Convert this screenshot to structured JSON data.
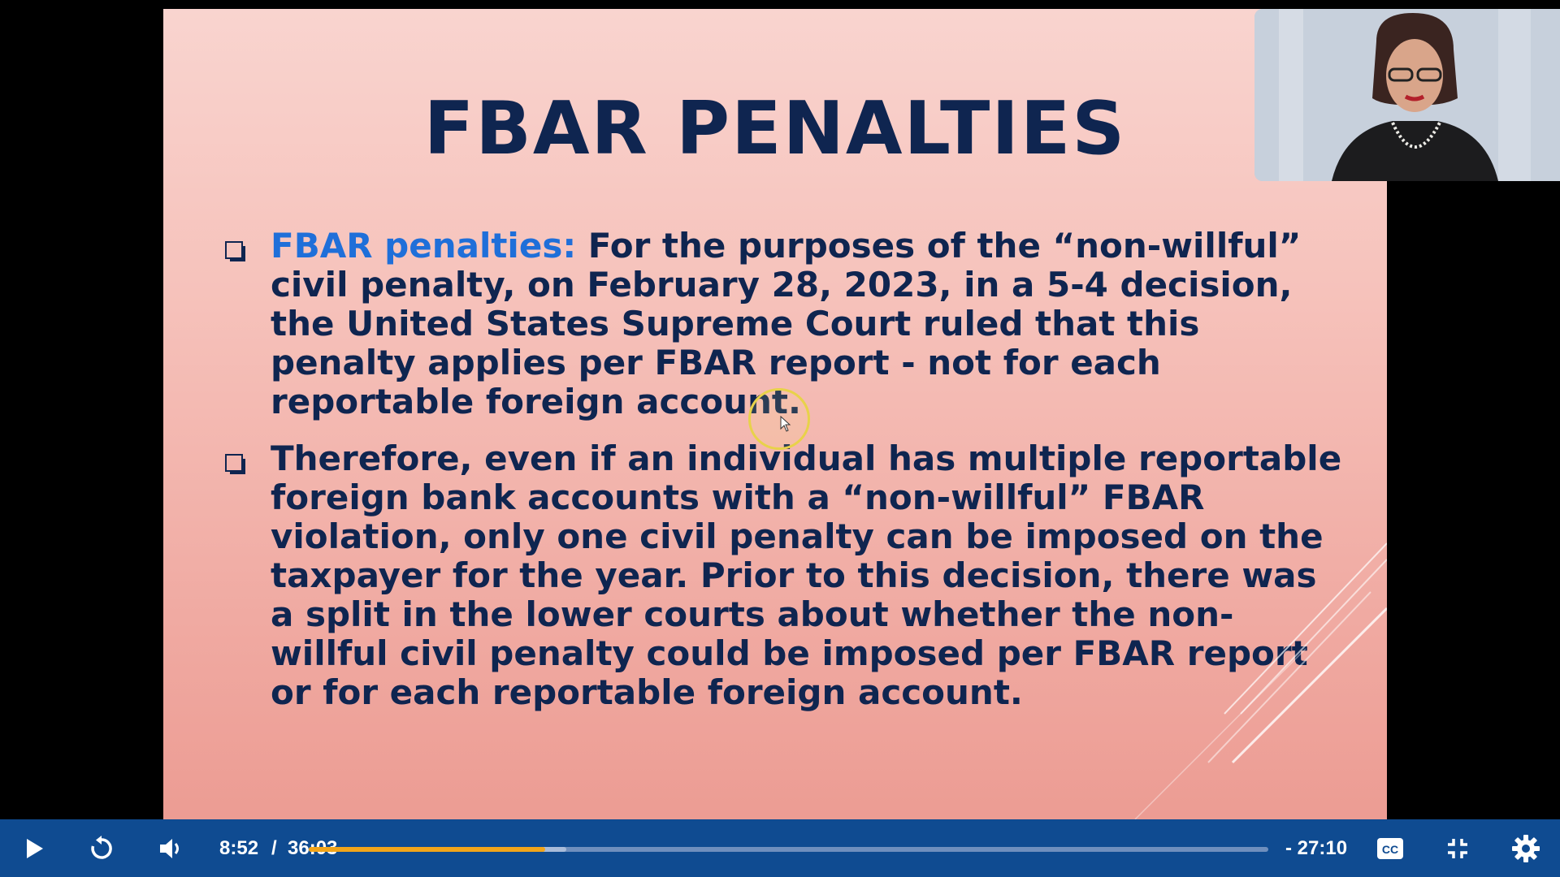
{
  "slide": {
    "title": "FBAR PENALTIES",
    "bullets": [
      {
        "highlight": "FBAR penalties:",
        "text": " For the purposes of the “non-willful” civil penalty, on February 28, 2023, in a 5-4 decision, the United States Supreme Court ruled that this penalty applies per FBAR report - not for each reportable foreign account."
      },
      {
        "highlight": "",
        "text": "Therefore, even if an individual has multiple reportable foreign bank accounts with a “non-willful” FBAR violation, only one civil penalty can be imposed on the taxpayer for the year. Prior to this decision, there was a split in the lower courts about whether the non-willful civil penalty could be imposed per FBAR report or for each reportable foreign account."
      }
    ]
  },
  "player": {
    "current_time": "8:52",
    "separator": "/",
    "duration": "36:03",
    "remaining": "- 27:10",
    "progress_fraction": 0.246,
    "buffered_fraction": 0.268,
    "accent_color": "#f2a51a",
    "bar_color": "#0f4b91",
    "icons": {
      "play": "play-icon",
      "replay": "replay-icon",
      "volume": "volume-icon",
      "captions": "captions-icon",
      "exit_fullscreen": "exit-fullscreen-icon",
      "settings": "gear-icon"
    }
  },
  "colors": {
    "slide_text": "#0f2550",
    "slide_highlight": "#1f6fd9"
  }
}
